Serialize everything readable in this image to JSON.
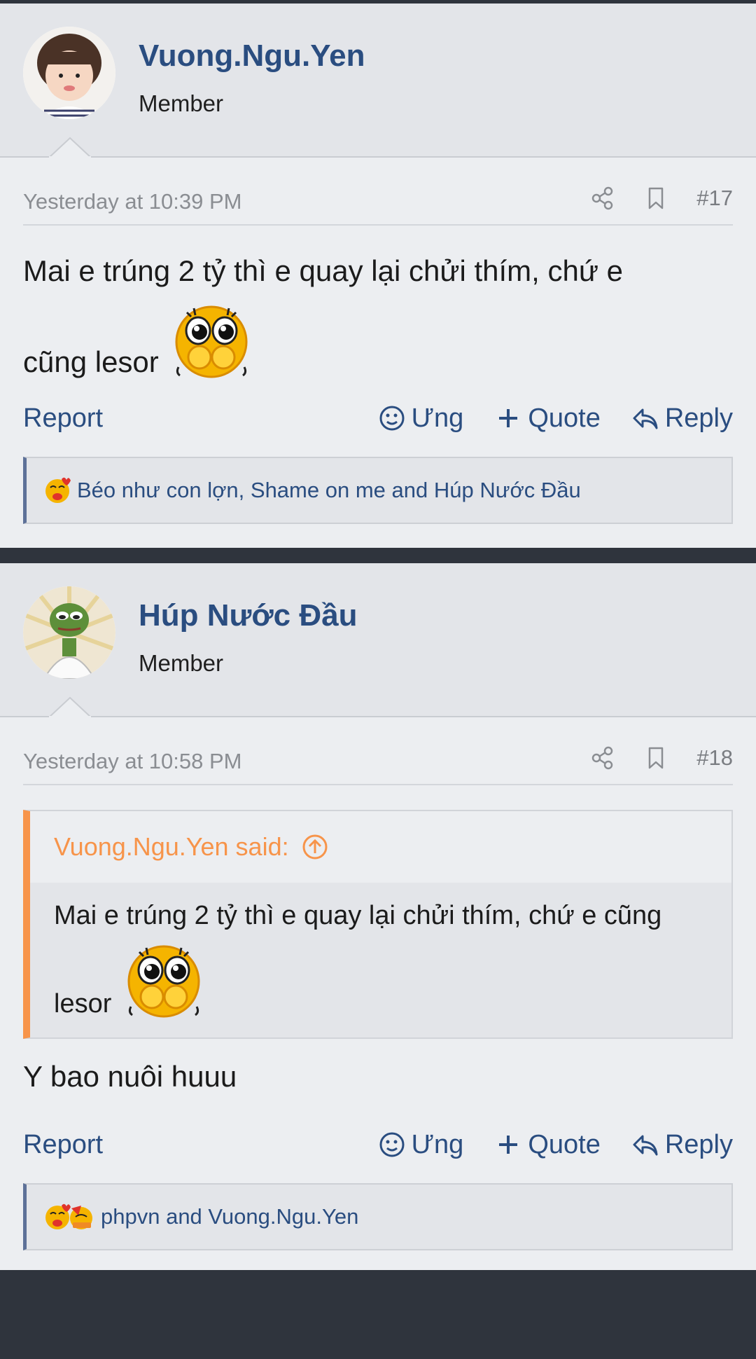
{
  "posts": [
    {
      "author": "Vuong.Ngu.Yen",
      "role": "Member",
      "time": "Yesterday at 10:39 PM",
      "number": "#17",
      "text_line1": "Mai e trúng 2 tỷ thì e quay lại chửi thím, chứ e",
      "text_line2": "cũng lesor",
      "actions": {
        "report": "Report",
        "react": "Ưng",
        "quote": "Quote",
        "reply": "Reply"
      },
      "reactions": "Béo như con lợn, Shame on me and Húp Nước Đầu"
    },
    {
      "author": "Húp Nước Đầu",
      "role": "Member",
      "time": "Yesterday at 10:58 PM",
      "number": "#18",
      "quote_author": "Vuong.Ngu.Yen said:",
      "quote_line1": "Mai e trúng 2 tỷ thì e quay lại chửi thím, chứ e cũng",
      "quote_line2": "lesor",
      "text": "Y bao nuôi huuu",
      "actions": {
        "report": "Report",
        "react": "Ưng",
        "quote": "Quote",
        "reply": "Reply"
      },
      "reactions": "phpvn and Vuong.Ngu.Yen"
    }
  ],
  "colors": {
    "link": "#2a4d80",
    "quote_accent": "#f7944a",
    "background": "#eceef1"
  },
  "icons": [
    "share-icon",
    "bookmark-icon",
    "react-face-icon",
    "plus-icon",
    "reply-arrow-icon",
    "arrow-circle-up-icon",
    "blush-emoji-icon",
    "kiss-emoji-icon"
  ]
}
